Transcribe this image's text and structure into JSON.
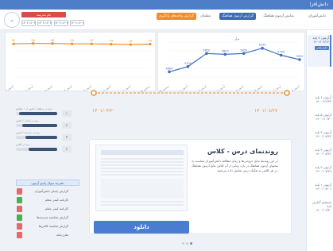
{
  "topbar": {
    "brand": "دانش‌افزا"
  },
  "header": {
    "school": "نام مدرسه",
    "avatar": "نام",
    "pills": [
      "۱۴۰۲-۱۴۰۳",
      "۱۴۰۳-۱۴۰۲",
      "۱۴۰۲-۱۴۰۳",
      "۱۴۰۲-۱۴۰۱"
    ],
    "tabs": [
      "دانش‌آموزان",
      "نمایش آزمون هماهنگ",
      "گزارش آزمون هماهنگ",
      "معلمان",
      "گزارش واحدهای یادگیری"
    ]
  },
  "sidebar": {
    "items": [
      {
        "title": "آزمون ۷ پایه",
        "date": "۱۴۰۱/۰۴/۱۴",
        "badge": "نتایج پایانی"
      },
      {
        "title": "آزمون ۶ پایه",
        "date": "۱۴۰۰/۱۲/۲۴"
      },
      {
        "title": "آزمون ۵ پایه",
        "date": "۱۴۰۰/۱۰/۲۰"
      },
      {
        "title": "آزمون ۴ پایه",
        "date": "۱۴۰۰/۰۹/۲۴"
      },
      {
        "title": "آزمون ۳ پایه",
        "date": "۱۴۰۰/۰۸/۲۶"
      },
      {
        "title": "آزمون ۲ پایه",
        "date": "۱۴۰۰/۰۷/۲۹"
      },
      {
        "title": "آزمون ۱ پایه",
        "date": "۱۴۰۰/۰۷/۰۱"
      },
      {
        "title": "سنجش آغازین پایه",
        "date": "۱۴۰۰/۰۶/۳۰"
      }
    ]
  },
  "line_chart": {
    "series_label": "تراز",
    "color": "#3f6ec0",
    "categories": [
      "سنجش آغازین",
      "آزمون ۱",
      "آزمون ۲",
      "آزمون ۳",
      "آزمون ۴",
      "آزمون ۵",
      "آزمون ۶",
      "آزمون ۷"
    ],
    "values": [
      4800,
      5100,
      5850,
      5800,
      5850,
      6150,
      5750,
      5500
    ]
  },
  "bar_chart": {
    "color": "#f28c28",
    "categories": [
      "آزمون ۷",
      "آزمون ۶",
      "آزمون ۵",
      "آزمون ۴",
      "آزمون ۳",
      "آزمون ۲",
      "آزمون ۱",
      "سنجش آغازین"
    ],
    "values": [
      95,
      96,
      96,
      95,
      95,
      94,
      93,
      94
    ]
  },
  "progress": [
    {
      "label": "رتبه در منطقه / کشور از ۱ مطابق",
      "value": "۱",
      "fill": 0.92
    },
    {
      "label": "رتبه در استان / کشور",
      "value": "۲",
      "fill": 0.85
    },
    {
      "label": "رتبه در مدرسه / کشور",
      "value": "۳",
      "fill": 0.78
    },
    {
      "label": "رتبه در کلاس",
      "value": "۴",
      "fill": 0.7
    }
  ],
  "reports": {
    "header": "دفترچه سوال پاسخ آزمون",
    "items": [
      "گزارش پایه‌ای دانش‌آموزان",
      "کارنامه کیفی معلم",
      "کارنامه کیفی معلم",
      "گزارش مقایسه مدرسه‌ها",
      "گزارش مقایسه کلاس‌ها",
      "تقارن‌نامه"
    ],
    "icons": [
      "red",
      "green",
      "red",
      "green",
      "red",
      "red"
    ]
  },
  "timeline": {
    "start": "۱۴۰۱/۰۴/۲۰",
    "end": "۱۴۰۱/۰۸/۲۷"
  },
  "card": {
    "title": "روندنمای درس - کلاس",
    "text": "در این روندنما نتایج خروجی‌ها و زمان مطالعه دانش‌آموزان متناسب با محتوای آزمون هماهنگ در بازه زمانی از آن کلاس نتایج آزمون هماهنگ در هر کلاس به تفکیک درس نمایش داده می‌شود.",
    "download": "دانلود"
  }
}
